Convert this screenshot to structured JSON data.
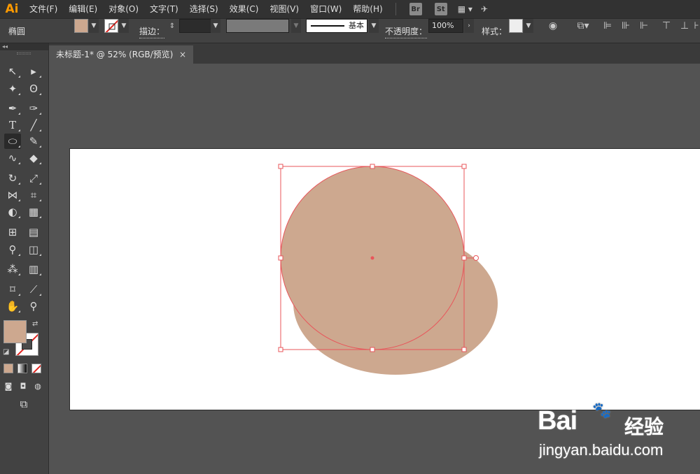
{
  "app": {
    "logo": "Ai"
  },
  "menu": [
    "文件(F)",
    "编辑(E)",
    "对象(O)",
    "文字(T)",
    "选择(S)",
    "效果(C)",
    "视图(V)",
    "窗口(W)",
    "帮助(H)"
  ],
  "app_badges": {
    "bridge": "Br",
    "stock": "St"
  },
  "control": {
    "selection_type": "椭圆",
    "fill_color": "#cda88f",
    "stroke_label": "描边：",
    "stroke_profile": "基本",
    "opacity_label": "不透明度：",
    "opacity_value": "100%",
    "style_label": "样式："
  },
  "document": {
    "tab_title": "未标题-1* @ 52% (RGB/预览)",
    "close": "×"
  },
  "toolbox": {
    "collapse": "◂◂",
    "fill_color": "#cda88f"
  },
  "artwork": {
    "shape_fill": "#cda88f",
    "selection_color": "#e8555a"
  },
  "watermark": {
    "brand": "Bai",
    "brand_cn": "经验",
    "url": "jingyan.baidu.com"
  }
}
